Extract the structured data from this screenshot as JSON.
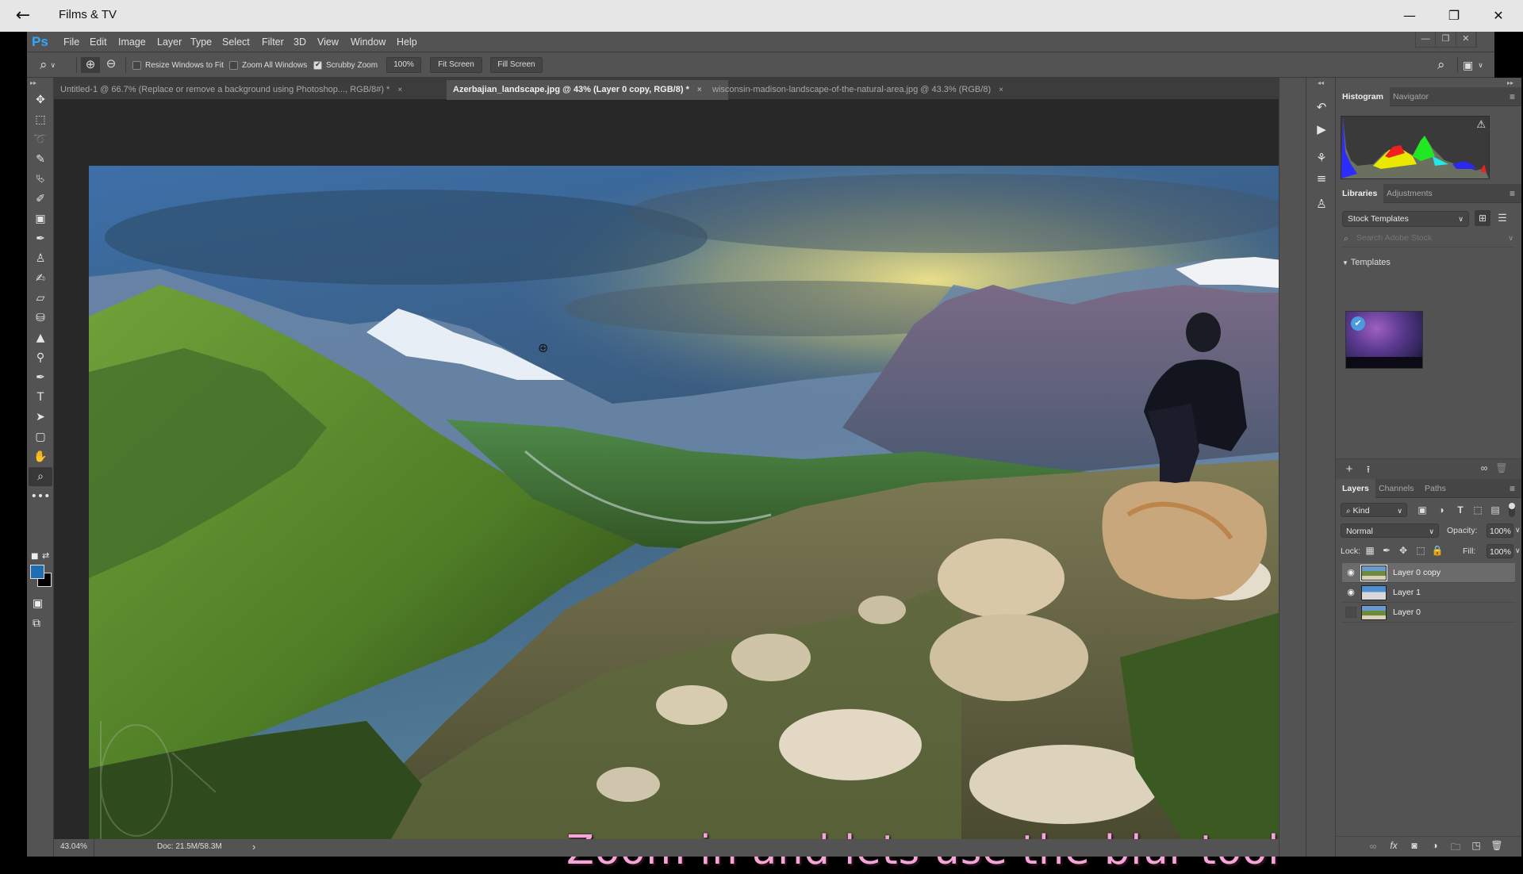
{
  "window": {
    "app_title": "Films & TV",
    "back_label": "←",
    "minimize_label": "—",
    "restore_label": "❐",
    "close_label": "✕"
  },
  "photoshop": {
    "logo": "Ps",
    "menu": [
      "File",
      "Edit",
      "Image",
      "Layer",
      "Type",
      "Select",
      "Filter",
      "3D",
      "View",
      "Window",
      "Help"
    ],
    "doc_controls": [
      "—",
      "❐",
      "✕"
    ]
  },
  "options_bar": {
    "tool_icon": "zoom-icon",
    "resize_windows_label": "Resize Windows to Fit",
    "resize_windows_checked": false,
    "zoom_all_label": "Zoom All Windows",
    "zoom_all_checked": false,
    "scrubby_label": "Scrubby Zoom",
    "scrubby_checked": true,
    "zoom_value": "100%",
    "fit_screen_label": "Fit Screen",
    "fill_screen_label": "Fill Screen"
  },
  "tabs": [
    {
      "label": "Untitled-1 @ 66.7% (Replace or remove a  background using Photoshop..., RGB/8#) *",
      "active": false
    },
    {
      "label": "Azerbajian_landscape.jpg @ 43% (Layer 0 copy, RGB/8) *",
      "active": true
    },
    {
      "label": "wisconsin-madison-landscape-of-the-natural-area.jpg @ 43.3% (RGB/8)",
      "active": false
    }
  ],
  "tab_close": "×",
  "tools": [
    {
      "name": "move-tool",
      "glyph": "✥"
    },
    {
      "name": "marquee-tool",
      "glyph": "⬚"
    },
    {
      "name": "lasso-tool",
      "glyph": "➰"
    },
    {
      "name": "quick-selection-tool",
      "glyph": "✎"
    },
    {
      "name": "crop-tool",
      "glyph": "⮱"
    },
    {
      "name": "eyedropper-tool",
      "glyph": "✐"
    },
    {
      "name": "healing-brush-tool",
      "glyph": "▣"
    },
    {
      "name": "brush-tool",
      "glyph": "✒"
    },
    {
      "name": "clone-stamp-tool",
      "glyph": "♙"
    },
    {
      "name": "history-brush-tool",
      "glyph": "✍"
    },
    {
      "name": "eraser-tool",
      "glyph": "▱"
    },
    {
      "name": "paint-bucket-tool",
      "glyph": "⛁"
    },
    {
      "name": "blur-tool",
      "glyph": "▲"
    },
    {
      "name": "dodge-tool",
      "glyph": "⚲"
    },
    {
      "name": "pen-tool",
      "glyph": "✒"
    },
    {
      "name": "type-tool",
      "glyph": "T"
    },
    {
      "name": "path-selection-tool",
      "glyph": "➤"
    },
    {
      "name": "shape-tool",
      "glyph": "▢"
    },
    {
      "name": "hand-tool",
      "glyph": "✋"
    },
    {
      "name": "zoom-tool",
      "glyph": "⌕"
    },
    {
      "name": "edit-toolbar",
      "glyph": "•••"
    }
  ],
  "foreground_color": "#1f6fb0",
  "background_color": "#000000",
  "status": {
    "zoom": "43.04%",
    "doc": "Doc: 21.5M/58.3M",
    "arrow": "›"
  },
  "subtitle": "Zoom in and lets use the blur tool",
  "icon_strip": [
    {
      "name": "history-icon",
      "glyph": "↶"
    },
    {
      "name": "actions-play-icon",
      "glyph": "▶"
    },
    {
      "name": "brush-presets-icon",
      "glyph": "⚘"
    },
    {
      "name": "brush-settings-icon",
      "glyph": "≡"
    },
    {
      "name": "clone-source-icon",
      "glyph": "♙"
    }
  ],
  "histogram_panel": {
    "tabs": [
      "Histogram",
      "Navigator"
    ],
    "warning_icon": "⚠"
  },
  "libraries_panel": {
    "tabs": [
      "Libraries",
      "Adjustments"
    ],
    "library_select": "Stock Templates",
    "search_placeholder": "Search Adobe Stock",
    "section_label": "Templates"
  },
  "layers_panel": {
    "tabs": [
      "Layers",
      "Channels",
      "Paths"
    ],
    "filter_kind": "Kind",
    "blend_mode": "Normal",
    "opacity_label": "Opacity:",
    "opacity_value": "100%",
    "lock_label": "Lock:",
    "fill_label": "Fill:",
    "fill_value": "100%",
    "layers": [
      {
        "name": "Layer 0 copy",
        "visible": true,
        "selected": true
      },
      {
        "name": "Layer 1",
        "visible": true,
        "selected": false
      },
      {
        "name": "Layer 0",
        "visible": false,
        "selected": false
      }
    ]
  }
}
